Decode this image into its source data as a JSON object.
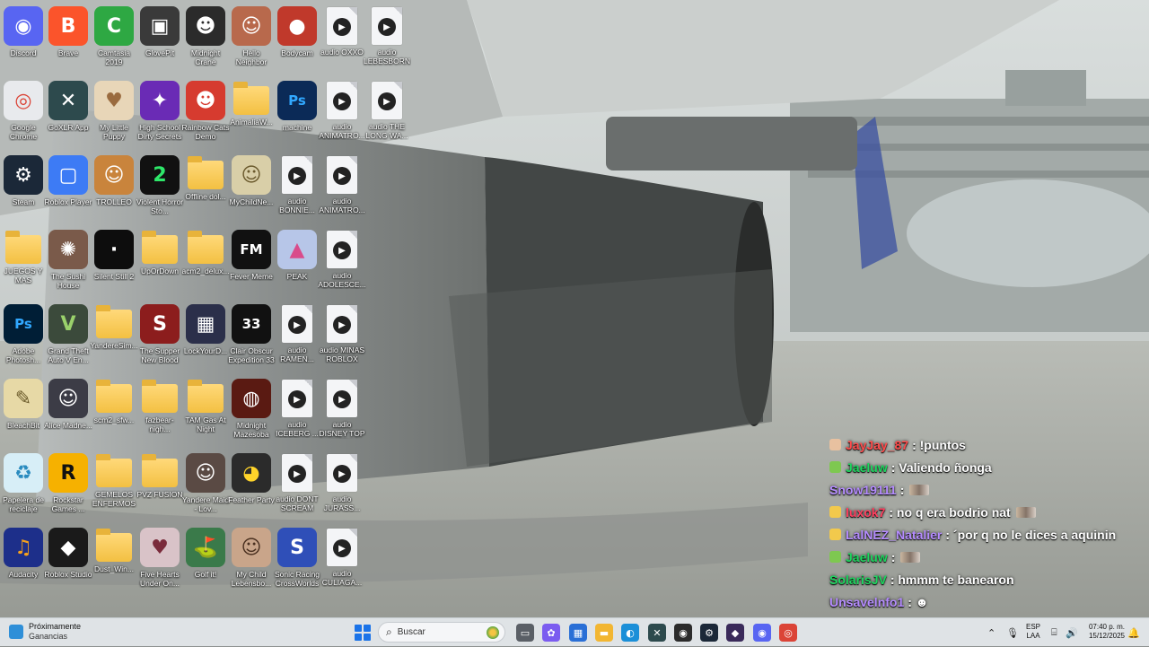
{
  "desktop": {
    "icons": [
      {
        "label": "Discord",
        "kind": "app",
        "bg": "#5865f2",
        "glyph": "◉"
      },
      {
        "label": "Brave",
        "kind": "app",
        "bg": "#fb542b",
        "glyph": "B"
      },
      {
        "label": "Camtasia 2019",
        "kind": "app",
        "bg": "#2ea843",
        "glyph": "C"
      },
      {
        "label": "GlovePit",
        "kind": "app",
        "bg": "#3a3a3a",
        "glyph": "▣"
      },
      {
        "label": "Midnight Crane",
        "kind": "app",
        "bg": "#2b2b2b",
        "glyph": "☻"
      },
      {
        "label": "Hello Neighbor",
        "kind": "app",
        "bg": "#b8694c",
        "glyph": "☺"
      },
      {
        "label": "Bodycam",
        "kind": "app",
        "bg": "#c0392b",
        "glyph": "●"
      },
      {
        "label": "audio OXXO",
        "kind": "audio"
      },
      {
        "label": "audio LEBESBORN...",
        "kind": "audio"
      },
      {
        "label": "Google Chrome",
        "kind": "app",
        "bg": "#e8eaed",
        "glyph": "◎",
        "fg": "#db4437"
      },
      {
        "label": "GoXLR App",
        "kind": "app",
        "bg": "#2d4a4d",
        "glyph": "✕"
      },
      {
        "label": "My Little Puppy",
        "kind": "app",
        "bg": "#e8d6b8",
        "glyph": "♥",
        "fg": "#9a6b3f"
      },
      {
        "label": "High School Dirty Secrets",
        "kind": "app",
        "bg": "#6a2bb5",
        "glyph": "✦"
      },
      {
        "label": "Rainbow Cats Demo",
        "kind": "app",
        "bg": "#d63b2f",
        "glyph": "☻"
      },
      {
        "label": "AnimaliaW...",
        "kind": "folder"
      },
      {
        "label": "machine",
        "kind": "app",
        "bg": "#0b2a57",
        "glyph": "Ps",
        "fg": "#31a8ff"
      },
      {
        "label": "audio ANIMATRO...",
        "kind": "audio"
      },
      {
        "label": "audio THE LONG WA...",
        "kind": "audio"
      },
      {
        "label": "Steam",
        "kind": "app",
        "bg": "#1b2838",
        "glyph": "⚙"
      },
      {
        "label": "Roblox Player",
        "kind": "app",
        "bg": "#3d7bf5",
        "glyph": "▢"
      },
      {
        "label": "TROLLEO",
        "kind": "app",
        "bg": "#c9843c",
        "glyph": "☺"
      },
      {
        "label": "Violent Horror Sto...",
        "kind": "app",
        "bg": "#111111",
        "glyph": "2",
        "fg": "#2ee86a"
      },
      {
        "label": "Offline dol...",
        "kind": "folder"
      },
      {
        "label": "MyChildNe...",
        "kind": "app",
        "bg": "#d9cfa8",
        "glyph": "☺",
        "fg": "#6b5a2d"
      },
      {
        "label": "audio BONNIE...",
        "kind": "audio"
      },
      {
        "label": "audio ANIMATRO...",
        "kind": "audio"
      },
      {
        "label": "",
        "kind": "empty"
      },
      {
        "label": "JUEGOS Y MAS",
        "kind": "folder"
      },
      {
        "label": "The Sushi House",
        "kind": "app",
        "bg": "#7a5a4a",
        "glyph": "✺"
      },
      {
        "label": "Silent Still 2",
        "kind": "app",
        "bg": "#0d0d0d",
        "glyph": "·"
      },
      {
        "label": "UpOrDown",
        "kind": "folder"
      },
      {
        "label": "acm2_delux...",
        "kind": "folder"
      },
      {
        "label": "Fever Meme",
        "kind": "app",
        "bg": "#111111",
        "glyph": "FM"
      },
      {
        "label": "PEAK",
        "kind": "app",
        "bg": "#b7c6e8",
        "glyph": "▲",
        "fg": "#d94c8b"
      },
      {
        "label": "audio ADOLESCE...",
        "kind": "audio"
      },
      {
        "label": "",
        "kind": "empty"
      },
      {
        "label": "Adobe Photosh...",
        "kind": "app",
        "bg": "#001e36",
        "glyph": "Ps",
        "fg": "#31a8ff"
      },
      {
        "label": "Grand Theft Auto V En...",
        "kind": "app",
        "bg": "#3b4a3b",
        "glyph": "V",
        "fg": "#9ad16b"
      },
      {
        "label": "YandereSim...",
        "kind": "folder"
      },
      {
        "label": "The Supper New Blood",
        "kind": "app",
        "bg": "#8c1d1d",
        "glyph": "S"
      },
      {
        "label": "LockYourD...",
        "kind": "app",
        "bg": "#2b2f4a",
        "glyph": "▦"
      },
      {
        "label": "Clair Obscur Expedition 33",
        "kind": "app",
        "bg": "#111111",
        "glyph": "33"
      },
      {
        "label": "audio RAMEN...",
        "kind": "audio"
      },
      {
        "label": "audio MINAS ROBLOX",
        "kind": "audio"
      },
      {
        "label": "",
        "kind": "empty"
      },
      {
        "label": "BleachBit",
        "kind": "app",
        "bg": "#e7d9a6",
        "glyph": "✎",
        "fg": "#6a5a2a"
      },
      {
        "label": "Alice Madne...",
        "kind": "app",
        "bg": "#3c3c46",
        "glyph": "☺"
      },
      {
        "label": "scm2_sfw...",
        "kind": "folder"
      },
      {
        "label": "fazbear-nigh...",
        "kind": "folder"
      },
      {
        "label": "TAM Gas At Night",
        "kind": "folder"
      },
      {
        "label": "Midnight Mazesoba",
        "kind": "app",
        "bg": "#5a1a12",
        "glyph": "◍"
      },
      {
        "label": "audio ICEBERG ...",
        "kind": "audio"
      },
      {
        "label": "audio DISNEY TOP NATX",
        "kind": "audio"
      },
      {
        "label": "",
        "kind": "empty"
      },
      {
        "label": "Papelera de reciclaje",
        "kind": "app",
        "bg": "#d7eef7",
        "glyph": "♻",
        "fg": "#2a8bbf"
      },
      {
        "label": "Rockstar Games ...",
        "kind": "app",
        "bg": "#f6b100",
        "glyph": "R",
        "fg": "#111111"
      },
      {
        "label": "GEMELOS ENFERMOS",
        "kind": "folder"
      },
      {
        "label": "PVZ FUSION",
        "kind": "folder"
      },
      {
        "label": "Yandere Maid - Lov...",
        "kind": "app",
        "bg": "#5a4a44",
        "glyph": "☺"
      },
      {
        "label": "Feather Party",
        "kind": "app",
        "bg": "#2b2b2b",
        "glyph": "◕",
        "fg": "#ffd42a"
      },
      {
        "label": "audio DONT SCREAM NAT",
        "kind": "audio"
      },
      {
        "label": "audio JURASS...",
        "kind": "audio"
      },
      {
        "label": "",
        "kind": "empty"
      },
      {
        "label": "Audacity",
        "kind": "app",
        "bg": "#1d2f8a",
        "glyph": "♫",
        "fg": "#f7a21b"
      },
      {
        "label": "Roblox Studio",
        "kind": "app",
        "bg": "#1a1a1a",
        "glyph": "◆"
      },
      {
        "label": "Dust_Win...",
        "kind": "folder"
      },
      {
        "label": "Five Hearts Under On...",
        "kind": "app",
        "bg": "#d9c3c8",
        "glyph": "♥",
        "fg": "#7a2b3b"
      },
      {
        "label": "Golf it!",
        "kind": "app",
        "bg": "#3a7a4a",
        "glyph": "⛳"
      },
      {
        "label": "My Child Lebensbo...",
        "kind": "app",
        "bg": "#c9a58a",
        "glyph": "☺",
        "fg": "#4a3020"
      },
      {
        "label": "Sonic Racing CrossWorlds",
        "kind": "app",
        "bg": "#2f4fb8",
        "glyph": "S"
      },
      {
        "label": "audio CULIAGA...",
        "kind": "audio"
      },
      {
        "label": "",
        "kind": "empty"
      }
    ]
  },
  "chat": {
    "messages": [
      {
        "user": "JayJay_87",
        "text": ": !puntos",
        "color": "#ff4d4d",
        "badge": "#e8c1a0",
        "emote": false
      },
      {
        "user": "Jaeluw",
        "text": ": Valiendo ñonga",
        "color": "#1ed760",
        "badge": "#7ec850",
        "emote": false
      },
      {
        "user": "Snow19111",
        "text": ":",
        "color": "#b58cff",
        "badge": "",
        "emote": true
      },
      {
        "user": "luxok7",
        "text": ": no q era bodrio nat",
        "color": "#ff4060",
        "badge": "#f2c94c",
        "emote": true
      },
      {
        "user": "LalNEZ_Natalier",
        "text": ": ´por q no le dices a aquinin",
        "color": "#b58cff",
        "badge": "#f2c94c",
        "emote": false
      },
      {
        "user": "Jaeluw",
        "text": ":",
        "color": "#1ed760",
        "badge": "#7ec850",
        "emote": true
      },
      {
        "user": "SolarisJV",
        "text": ": hmmm te banearon",
        "color": "#1ed760",
        "badge": "",
        "emote": false
      },
      {
        "user": "Unsavelnfo1",
        "text": ": ☻",
        "color": "#b58cff",
        "badge": "",
        "emote": false
      }
    ]
  },
  "taskbar": {
    "widget_title": "Próximamente",
    "widget_subtitle": "Ganancias",
    "search_placeholder": "Buscar",
    "apps": [
      {
        "name": "task-view",
        "glyph": "▭",
        "bg": "#5a5f66"
      },
      {
        "name": "copilot",
        "glyph": "✿",
        "bg": "#7b5cf0"
      },
      {
        "name": "microsoft-store",
        "glyph": "▦",
        "bg": "#2a6fd6"
      },
      {
        "name": "file-explorer",
        "glyph": "▬",
        "bg": "#f2b632"
      },
      {
        "name": "edge",
        "glyph": "◐",
        "bg": "#1b8fd8"
      },
      {
        "name": "goxlr",
        "glyph": "✕",
        "bg": "#2d4a4d"
      },
      {
        "name": "obs",
        "glyph": "◉",
        "bg": "#2b2b2b"
      },
      {
        "name": "steam",
        "glyph": "⚙",
        "bg": "#1b2838"
      },
      {
        "name": "battle",
        "glyph": "◆",
        "bg": "#3a2a5a"
      },
      {
        "name": "discord",
        "glyph": "◉",
        "bg": "#5865f2"
      },
      {
        "name": "chrome",
        "glyph": "◎",
        "bg": "#db4437"
      }
    ],
    "language_top": "ESP",
    "language_bottom": "LAA",
    "time": "07:40 p. m.",
    "date": "15/12/2025"
  }
}
